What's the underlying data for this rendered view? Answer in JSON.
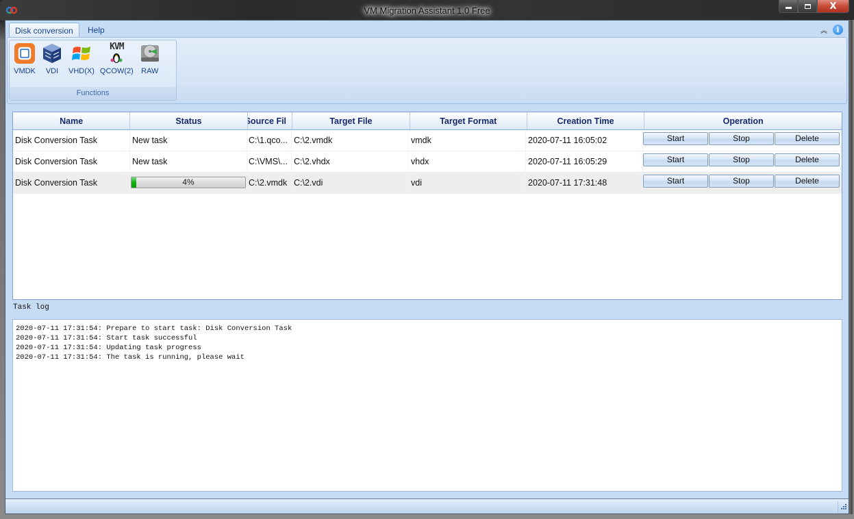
{
  "window": {
    "title": "VM Migration Assistant 1.0 Free",
    "caption_buttons": {
      "minimize": "—",
      "maximize": "□",
      "close": "X"
    }
  },
  "ribbon": {
    "tabs": [
      {
        "label": "Disk conversion",
        "active": true
      },
      {
        "label": "Help",
        "active": false
      }
    ],
    "info_icon": "i",
    "collapse_icon": "︽",
    "groups": [
      {
        "label": "Functions",
        "items": [
          {
            "label": "VMDK",
            "icon": "vmware-icon"
          },
          {
            "label": "VDI",
            "icon": "virtualbox-icon"
          },
          {
            "label": "VHD(X)",
            "icon": "windows-icon"
          },
          {
            "label": "QCOW(2)",
            "icon": "kvm-icon",
            "icon_text": "KVM"
          },
          {
            "label": "RAW",
            "icon": "hard-disk-icon"
          }
        ]
      }
    ]
  },
  "task_table": {
    "columns": [
      "Name",
      "Status",
      "Source File",
      "Target File",
      "Target Format",
      "Creation Time",
      "Operation"
    ],
    "header_visible": {
      "Source File": "Source Fil"
    },
    "rows": [
      {
        "name": "Disk Conversion Task",
        "status": "New task",
        "progress": null,
        "source": "C:\\1.qco...",
        "target": "C:\\2.vmdk",
        "format": "vmdk",
        "created": "2020-07-11 16:05:02"
      },
      {
        "name": "Disk Conversion Task",
        "status": "New task",
        "progress": null,
        "source": "C:\\VMS\\...",
        "target": "C:\\2.vhdx",
        "format": "vhdx",
        "created": "2020-07-11 16:05:29"
      },
      {
        "name": "Disk Conversion Task",
        "status": "",
        "progress": 4,
        "progress_label": "4%",
        "source": "C:\\2.vmdk",
        "target": "C:\\2.vdi",
        "format": "vdi",
        "created": "2020-07-11 17:31:48"
      }
    ],
    "operations": [
      "Start",
      "Stop",
      "Delete"
    ]
  },
  "task_log": {
    "label": "Task log",
    "lines": [
      "2020-07-11 17:31:54: Prepare to start task: Disk Conversion Task",
      "2020-07-11 17:31:54: Start task successful",
      "2020-07-11 17:31:54: Updating task progress",
      "2020-07-11 17:31:54: The task is running, please wait"
    ]
  },
  "colors": {
    "header_text": "#15286b",
    "ribbon_text": "#15428b",
    "progress_green": "#13b013",
    "client_bg": "#c6dcf4"
  }
}
